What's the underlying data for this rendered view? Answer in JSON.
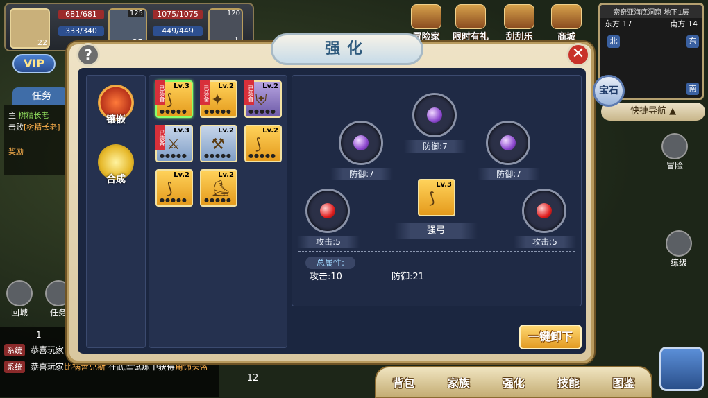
{
  "player": {
    "level": "22",
    "hp": "681/681",
    "mp": "333/340",
    "pet_level": "25",
    "pet_top": "125",
    "pet_hp": "1075/1075",
    "pet_mp": "449/449",
    "mount_level": "1",
    "mount_top": "120",
    "vip": "VIP"
  },
  "top_menu": [
    "冒险家",
    "限时有礼",
    "刮刮乐",
    "商城"
  ],
  "minimap": {
    "title": "索奇亚海底洞窟 地下1层",
    "east_coord": "东方 17",
    "south_coord": "南方 14",
    "north": "北",
    "east": "东",
    "south": "南"
  },
  "quick_nav": "快捷导航",
  "side_right": {
    "adventure": "冒险",
    "practice": "练级"
  },
  "task": {
    "tab": "任务",
    "main_tag": "主",
    "title": "树精长老",
    "desc_prefix": "击败",
    "desc_target": "[树精长老]",
    "reward": "奖励"
  },
  "side_left": {
    "return_city": "回城",
    "task": "任务"
  },
  "chat": {
    "count": "1",
    "rows": [
      {
        "tag": "系统",
        "text": "恭喜玩家"
      },
      {
        "tag": "系统",
        "text": "恭喜玩家",
        "name": "比祸善克斯",
        "mid": "在武库试炼中获得",
        "item": "角饰头盔"
      }
    ],
    "bottom_number": "12"
  },
  "bottom_menu": [
    "背包",
    "家族",
    "强化",
    "技能",
    "图鉴"
  ],
  "dialog": {
    "title": "强化",
    "help": "?",
    "close": "✕",
    "modes": [
      {
        "label": "镶嵌"
      },
      {
        "label": "合成"
      }
    ],
    "equipped_tag": "已装备",
    "items": [
      {
        "lv": "Lv.3",
        "equipped": true,
        "color": "gold",
        "glyph": "⟆",
        "selected": true
      },
      {
        "lv": "Lv.2",
        "equipped": true,
        "color": "gold",
        "glyph": "✦"
      },
      {
        "lv": "Lv.2",
        "equipped": true,
        "color": "purple",
        "glyph": "⛨"
      },
      {
        "lv": "Lv.3",
        "equipped": true,
        "color": "blue",
        "glyph": "⚔"
      },
      {
        "lv": "Lv.2",
        "equipped": false,
        "color": "blue",
        "glyph": "⚒"
      },
      {
        "lv": "Lv.2",
        "equipped": false,
        "color": "gold",
        "glyph": "⟆"
      },
      {
        "lv": "Lv.2",
        "equipped": false,
        "color": "gold",
        "glyph": "⟆"
      },
      {
        "lv": "Lv.2",
        "equipped": false,
        "color": "gold",
        "glyph": "⛸"
      }
    ],
    "sockets": [
      {
        "label": "防御:7",
        "gem": "purple"
      },
      {
        "label": "防御:7",
        "gem": "purple"
      },
      {
        "label": "防御:7",
        "gem": "purple"
      },
      {
        "label": "攻击:5",
        "gem": "red"
      },
      {
        "label": "攻击:5",
        "gem": "red"
      }
    ],
    "center_item": {
      "lv": "Lv.3",
      "name": "强弓"
    },
    "total_label": "总属性:",
    "total_attack": "攻击:10",
    "total_defense": "防御:21",
    "unload_button": "一键卸下",
    "gem_tab": "宝石"
  }
}
